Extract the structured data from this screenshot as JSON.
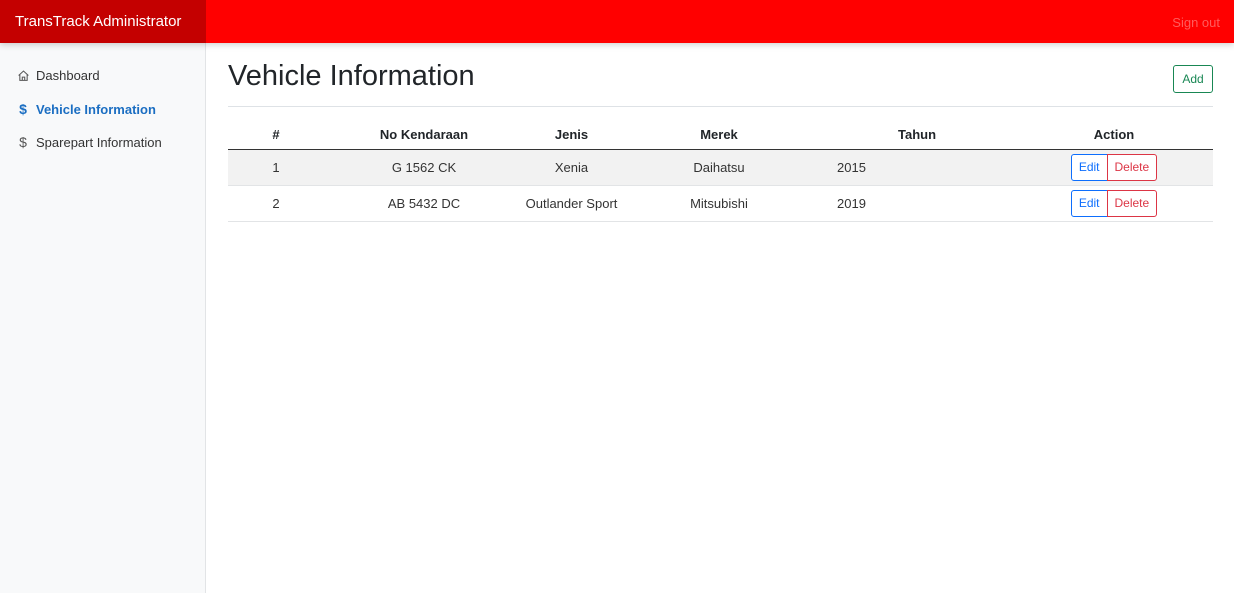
{
  "app": {
    "brand": "TransTrack Administrator",
    "signout_label": "Sign out"
  },
  "colors": {
    "navbar": "#ff0000",
    "brand_bg": "#c40000",
    "active": "#1b6ec2",
    "add": "#198754",
    "edit": "#0d6efd",
    "delete": "#dc3545"
  },
  "sidebar": {
    "items": [
      {
        "label": "Dashboard",
        "icon": "home-icon"
      },
      {
        "label": "Vehicle Information",
        "icon": "dollar-icon",
        "active": true
      },
      {
        "label": "Sparepart Information",
        "icon": "dollar-icon"
      }
    ]
  },
  "main": {
    "title": "Vehicle Information",
    "add_label": "Add",
    "table": {
      "headers": [
        "#",
        "No Kendaraan",
        "Jenis",
        "Merek",
        "Tahun",
        "Action"
      ],
      "rows": [
        {
          "no": "1",
          "plate": "G 1562 CK",
          "type": "Xenia",
          "brand": "Daihatsu",
          "year": "2015",
          "edit": "Edit",
          "delete": "Delete"
        },
        {
          "no": "2",
          "plate": "AB 5432 DC",
          "type": "Outlander Sport",
          "brand": "Mitsubishi",
          "year": "2019",
          "edit": "Edit",
          "delete": "Delete"
        }
      ]
    }
  }
}
